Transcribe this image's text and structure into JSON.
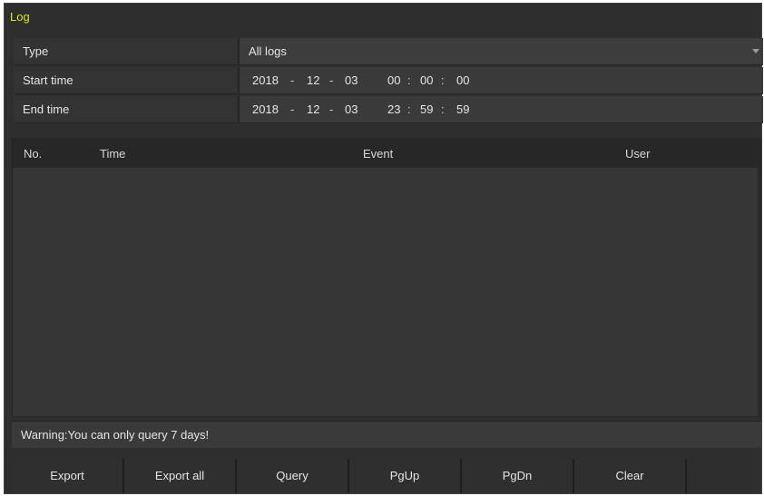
{
  "window": {
    "title": "Log"
  },
  "filters": {
    "type": {
      "label": "Type",
      "value": "All logs"
    },
    "start_time": {
      "label": "Start time",
      "year": "2018",
      "month": "12",
      "day": "03",
      "hour": "00",
      "minute": "00",
      "second": "00"
    },
    "end_time": {
      "label": "End time",
      "year": "2018",
      "month": "12",
      "day": "03",
      "hour": "23",
      "minute": "59",
      "second": "59"
    },
    "date_sep": "-",
    "time_sep": ":"
  },
  "table": {
    "columns": [
      "No.",
      "Time",
      "Event",
      "User"
    ],
    "rows": []
  },
  "warning": "Warning:You can only query 7 days!",
  "buttons": {
    "export": "Export",
    "export_all": "Export all",
    "query": "Query",
    "pgup": "PgUp",
    "pgdn": "PgDn",
    "clear": "Clear"
  },
  "colors": {
    "title": "#d6e81e",
    "panel": "#2e2e2e",
    "header": "#272727"
  }
}
